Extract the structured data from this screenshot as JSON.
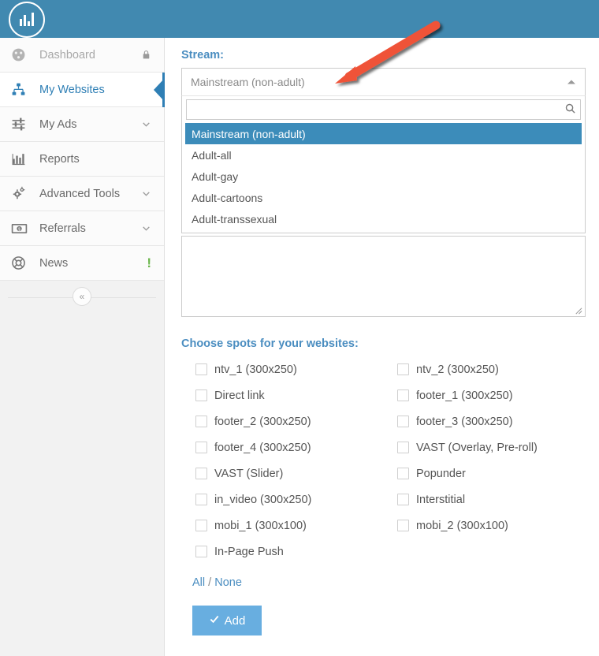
{
  "brand": {
    "logo_icon": "bar-chart-circle-logo"
  },
  "sidebar": {
    "items": [
      {
        "label": "Dashboard",
        "icon": "dashboard-gauge-icon",
        "state": "disabled",
        "right_icon": "lock-icon"
      },
      {
        "label": "My Websites",
        "icon": "sitemap-icon",
        "state": "active",
        "right_icon": ""
      },
      {
        "label": "My Ads",
        "icon": "sliders-icon",
        "state": "normal",
        "right_icon": "chevron-down-icon"
      },
      {
        "label": "Reports",
        "icon": "bar-chart-icon",
        "state": "normal",
        "right_icon": ""
      },
      {
        "label": "Advanced Tools",
        "icon": "gears-icon",
        "state": "normal",
        "right_icon": "chevron-down-icon"
      },
      {
        "label": "Referrals",
        "icon": "money-bill-icon",
        "state": "normal",
        "right_icon": "chevron-down-icon"
      },
      {
        "label": "News",
        "icon": "lifebuoy-icon",
        "state": "normal",
        "right_icon": "exclamation-badge"
      }
    ],
    "collapse_label": "«"
  },
  "stream": {
    "label": "Stream:",
    "selected": "Mainstream (non-adult)",
    "search_value": "",
    "search_placeholder": "",
    "search_icon": "search-icon",
    "toggle_icon": "caret-up-icon",
    "options": [
      "Mainstream (non-adult)",
      "Adult-all",
      "Adult-gay",
      "Adult-cartoons",
      "Adult-transsexual"
    ],
    "selected_index": 0
  },
  "sites_textarea": {
    "value": "",
    "resize_grip_icon": "resize-grip-icon"
  },
  "spots": {
    "title": "Choose spots for your websites:",
    "rows": [
      [
        {
          "label": "ntv_1 (300x250)",
          "checked": false
        },
        {
          "label": "ntv_2 (300x250)",
          "checked": false
        }
      ],
      [
        {
          "label": "Direct link",
          "checked": false
        },
        {
          "label": "footer_1 (300x250)",
          "checked": false
        }
      ],
      [
        {
          "label": "footer_2 (300x250)",
          "checked": false
        },
        {
          "label": "footer_3 (300x250)",
          "checked": false
        }
      ],
      [
        {
          "label": "footer_4 (300x250)",
          "checked": false
        },
        {
          "label": "VAST (Overlay, Pre-roll)",
          "checked": false
        }
      ],
      [
        {
          "label": "VAST (Slider)",
          "checked": false
        },
        {
          "label": "Popunder",
          "checked": false
        }
      ],
      [
        {
          "label": "in_video (300x250)",
          "checked": false
        },
        {
          "label": "Interstitial",
          "checked": false
        }
      ],
      [
        {
          "label": "mobi_1 (300x100)",
          "checked": false
        },
        {
          "label": "mobi_2 (300x100)",
          "checked": false
        }
      ],
      [
        {
          "label": "In-Page Push",
          "checked": false
        },
        null
      ]
    ],
    "all_label": "All",
    "separator": "/",
    "none_label": "None"
  },
  "add_button": {
    "label": "Add",
    "icon": "check-icon"
  },
  "annotation": {
    "type": "arrow",
    "color": "#ef5239",
    "points_to": "stream-select-toggle"
  },
  "colors": {
    "header_blue": "#4189b0",
    "accent_blue": "#4a8dc0",
    "option_highlight": "#3c8cba",
    "button_blue": "#68aee0",
    "arrow_red": "#ef5239",
    "badge_green": "#6ab64b",
    "sidebar_bg": "#f2f2f2"
  }
}
